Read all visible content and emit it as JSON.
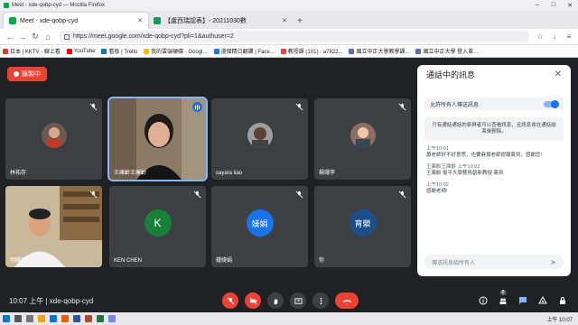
{
  "window": {
    "title": "Meet - xde-qobp-cyd — Mozilla Firefox"
  },
  "tabs": [
    {
      "label": "Meet - xde-qobp-cyd",
      "color": "#00ac47",
      "active": true
    },
    {
      "label": "【盧西瑞認表】- 20211030數",
      "color": "#0f9d58",
      "active": false
    }
  ],
  "url": "https://meet.google.com/xde-qobp-cyd?pli=1&authuser=2",
  "bookmarks": [
    {
      "label": "日本 | KKTV - 線上看",
      "color": "#e53935"
    },
    {
      "label": "YouTube",
      "color": "#ff0000"
    },
    {
      "label": "看板 | Trello",
      "color": "#0079bf"
    },
    {
      "label": "我的雲端硬碟 - Googl...",
      "color": "#fbbc04"
    },
    {
      "label": "漫傑精日翻譯 | Face...",
      "color": "#1877f2"
    },
    {
      "label": "教授課 (101) - a7822...",
      "color": "#ea4335"
    },
    {
      "label": "國立中正大學教學課...",
      "color": "#5c6bc0"
    },
    {
      "label": "國立中正大學 登入單...",
      "color": "#5c6bc0"
    }
  ],
  "recording": {
    "label": "錄製中"
  },
  "participants": [
    {
      "name": "林祐存",
      "type": "photo",
      "muted": true
    },
    {
      "name": "王庫齡王庫齡",
      "type": "video",
      "muted": false
    },
    {
      "name": "sayara liao",
      "type": "photo",
      "muted": true
    },
    {
      "name": "楊珊李",
      "type": "photo",
      "muted": true
    },
    {
      "name": "明耀平",
      "type": "video",
      "muted": true
    },
    {
      "name": "KEN CHEN",
      "type": "letter",
      "letter": "K",
      "color": "#188038",
      "muted": true
    },
    {
      "name": "鍾媄娟",
      "type": "letter",
      "letter": "媄娟",
      "color": "#1a73e8",
      "muted": true
    },
    {
      "name": "你",
      "type": "letter",
      "letter": "育縈",
      "color": "#1a4f8a",
      "muted": true
    }
  ],
  "meeting": {
    "time": "10:07 上午",
    "code": "xde-qobp-cyd"
  },
  "controls": {
    "people_count": "8"
  },
  "chat": {
    "title": "通話中的訊息",
    "allow_label": "允許所有人傳送訊息",
    "notice": "只有通話通話的參與者可以查看訊息，且訊息會在通話結束後刪除。",
    "messages": [
      {
        "time": "上午10:01",
        "text": "蕭老師好不好意思，也要麻煩老師提報簽到，感謝您!"
      },
      {
        "time": "王庫齡王庫齡 上午10:02",
        "text": "王庫齡 復平大學藝術創新教授 簽到"
      },
      {
        "time": "上午10:02",
        "text": "感謝老師!"
      }
    ],
    "input_placeholder": "傳送訊息給所有人"
  },
  "taskbar": {
    "clock": "上午 10:07"
  },
  "colors": {
    "meet_bg": "#202124",
    "tile_bg": "#3c4043",
    "red": "#ea4335",
    "blue": "#1a73e8"
  }
}
